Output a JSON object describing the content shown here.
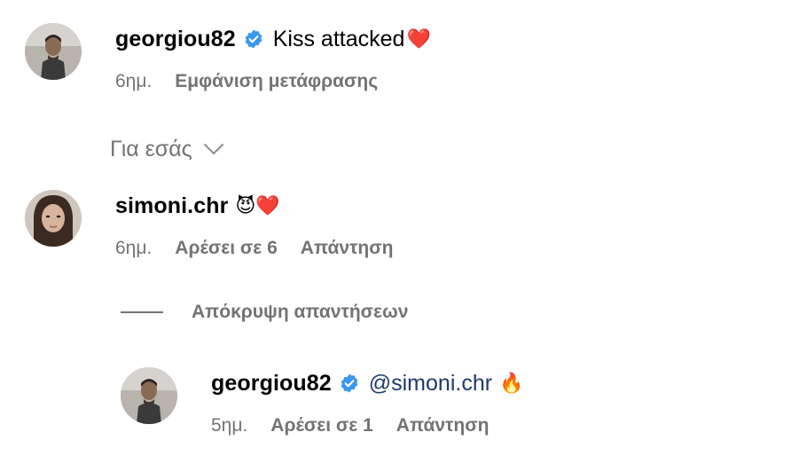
{
  "comments": [
    {
      "username": "georgiou82",
      "verified": true,
      "text": "Kiss attacked",
      "emoji": "❤️",
      "time": "6ημ.",
      "actions": [
        "Εμφάνιση μετάφρασης"
      ]
    },
    {
      "username": "simoni.chr",
      "verified": false,
      "text": "",
      "emoji": "😈❤️",
      "time": "6ημ.",
      "actions": [
        "Αρέσει σε 6",
        "Απάντηση"
      ]
    }
  ],
  "reply": {
    "username": "georgiou82",
    "verified": true,
    "mention": "@simoni.chr",
    "emoji": "🔥",
    "time": "5ημ.",
    "actions": [
      "Αρέσει σε 1",
      "Απάντηση"
    ]
  },
  "sort": {
    "label": "Για εσάς",
    "icon": "chevron-down-icon"
  },
  "hide_replies": {
    "label": "Απόκρυψη απαντήσεων"
  },
  "colors": {
    "verified_badge": "#3897f0",
    "secondary_text": "#737373",
    "mention": "#1e3a6b"
  }
}
